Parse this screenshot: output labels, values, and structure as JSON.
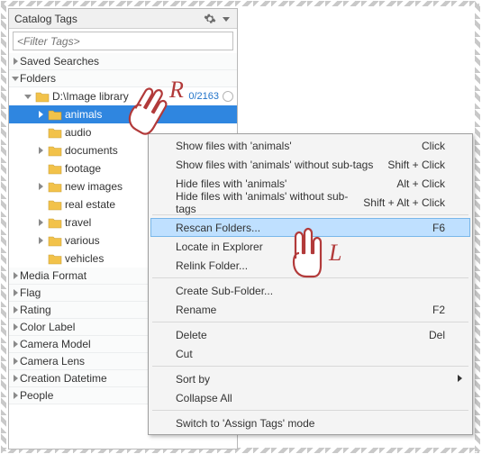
{
  "panel": {
    "title": "Catalog Tags",
    "filter_placeholder": "<Filter Tags>"
  },
  "categories": {
    "saved_searches": "Saved Searches",
    "folders": "Folders",
    "media_format": "Media Format",
    "flag": "Flag",
    "rating": "Rating",
    "color_label": "Color Label",
    "camera_model": "Camera Model",
    "camera_lens": "Camera Lens",
    "creation_datetime": "Creation Datetime",
    "people": "People"
  },
  "tree": {
    "root": {
      "label": "D:\\Image library",
      "count": "0/2163"
    },
    "items": [
      {
        "label": "animals"
      },
      {
        "label": "audio"
      },
      {
        "label": "documents"
      },
      {
        "label": "footage"
      },
      {
        "label": "new images"
      },
      {
        "label": "real estate"
      },
      {
        "label": "travel"
      },
      {
        "label": "various"
      },
      {
        "label": "vehicles"
      }
    ]
  },
  "menu": {
    "show_tag": {
      "label": "Show files with 'animals'",
      "shortcut": "Click"
    },
    "show_tag_nosub": {
      "label": "Show files with 'animals' without sub-tags",
      "shortcut": "Shift + Click"
    },
    "hide_tag": {
      "label": "Hide files with 'animals'",
      "shortcut": "Alt + Click"
    },
    "hide_tag_nosub": {
      "label": "Hide files with 'animals' without sub-tags",
      "shortcut": "Shift + Alt + Click"
    },
    "rescan": {
      "label": "Rescan Folders...",
      "shortcut": "F6"
    },
    "locate": {
      "label": "Locate in Explorer"
    },
    "relink": {
      "label": "Relink Folder..."
    },
    "create_sub": {
      "label": "Create Sub-Folder..."
    },
    "rename": {
      "label": "Rename",
      "shortcut": "F2"
    },
    "delete": {
      "label": "Delete",
      "shortcut": "Del"
    },
    "cut": {
      "label": "Cut"
    },
    "sort_by": {
      "label": "Sort by"
    },
    "collapse": {
      "label": "Collapse All"
    },
    "switch_mode": {
      "label": "Switch to 'Assign Tags' mode"
    }
  },
  "annotations": {
    "right_click": "R",
    "left_click": "L"
  }
}
